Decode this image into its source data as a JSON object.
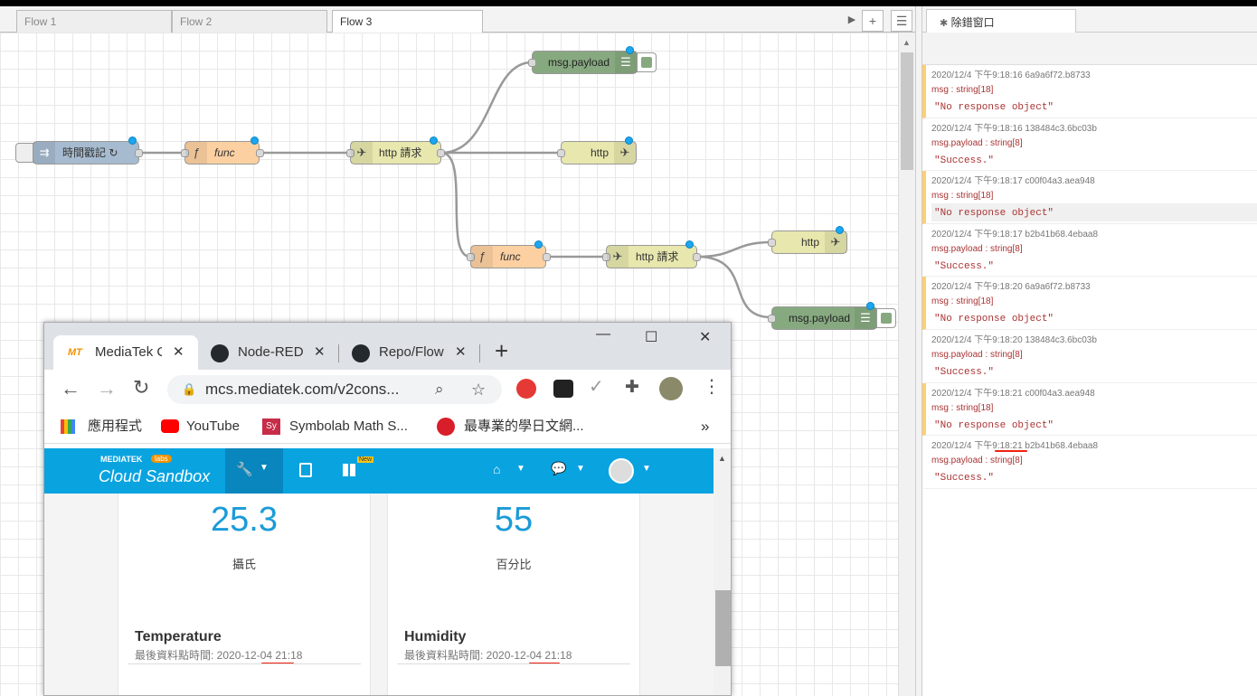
{
  "nodered": {
    "tabs": [
      "Flow 1",
      "Flow 2",
      "Flow 3"
    ],
    "tab_buttons": {
      "scroll": "▶",
      "add": "+",
      "menu": "☰"
    },
    "nodes": {
      "timestamp": "時間戳記 ↻",
      "func1": "func",
      "http_req1": "http 請求",
      "debug1": "msg.payload",
      "http_resp1": "http",
      "func2": "func",
      "http_req2": "http 請求",
      "http_resp2": "http",
      "debug2": "msg.payload"
    },
    "icons": {
      "inject": "arrow-right-icon",
      "function": "function-icon",
      "http": "globe-icon",
      "debug": "list-icon"
    }
  },
  "sidebar": {
    "tab_label": "除錯窗口",
    "messages": [
      {
        "meta": "2020/12/4 下午9:18:16   6a9a6f72.b8733",
        "topic": "msg : string[18]",
        "value": "\"No response object\""
      },
      {
        "meta": "2020/12/4 下午9:18:16   138484c3.6bc03b",
        "topic": "msg.payload : string[8]",
        "value": "\"Success.\""
      },
      {
        "meta": "2020/12/4 下午9:18:17   c00f04a3.aea948",
        "topic": "msg : string[18]",
        "value": "\"No response object\""
      },
      {
        "meta": "2020/12/4 下午9:18:17   b2b41b68.4ebaa8",
        "topic": "msg.payload : string[8]",
        "value": "\"Success.\""
      },
      {
        "meta": "2020/12/4 下午9:18:20   6a9a6f72.b8733",
        "topic": "msg : string[18]",
        "value": "\"No response object\""
      },
      {
        "meta": "2020/12/4 下午9:18:20   138484c3.6bc03b",
        "topic": "msg.payload : string[8]",
        "value": "\"Success.\""
      },
      {
        "meta": "2020/12/4 下午9:18:21   c00f04a3.aea948",
        "topic": "msg : string[18]",
        "value": "\"No response object\""
      },
      {
        "meta": "2020/12/4 下午9:18:21   b2b41b68.4ebaa8",
        "topic": "msg.payload : string[8]",
        "value": "\"Success.\""
      }
    ]
  },
  "browser": {
    "tabs": [
      {
        "icon": "MT",
        "label": "MediaTek C"
      },
      {
        "icon": "github-icon",
        "label": "Node-RED"
      },
      {
        "icon": "github-icon",
        "label": "Repo/Flow"
      }
    ],
    "new_tab": "+",
    "window_buttons": {
      "minimize": "—",
      "maximize": "☐",
      "close": "✕"
    },
    "url": "mcs.mediatek.com/v2cons...",
    "bookmarks": [
      "應用程式",
      "YouTube",
      "Symbolab Math S...",
      "最專業的學日文網..."
    ],
    "bookmark_more": "»",
    "symbolab_badge": "Sy",
    "brand_top": "MEDIATEK",
    "brand_labs": "labs",
    "brand_name": "Cloud Sandbox",
    "new_badge": "New",
    "cards": [
      {
        "value": "25.3",
        "unit": "攝氏",
        "title": "Temperature",
        "last": "最後資料點時間: 2020-12-04 21:18"
      },
      {
        "value": "55",
        "unit": "百分比",
        "title": "Humidity",
        "last": "最後資料點時間: 2020-12-04 21:18"
      }
    ]
  },
  "colors": {
    "inject": "#a6bbcf",
    "function": "#fdd0a2",
    "http": "#e7e7ae",
    "debug": "#87a980",
    "mcs_header": "#09a3e0",
    "accent_value": "#1a9bd7",
    "warn_bar": "#ffcf70"
  }
}
